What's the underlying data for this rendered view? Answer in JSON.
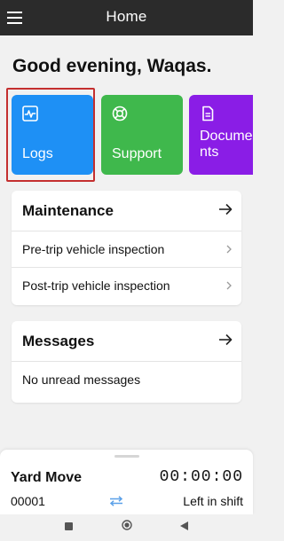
{
  "header": {
    "title": "Home",
    "menu_icon": "hamburger-menu-icon"
  },
  "greeting": "Good evening, Waqas.",
  "tiles": [
    {
      "label": "Logs",
      "icon": "activity-log-icon",
      "color": "#1e90f5"
    },
    {
      "label": "Support",
      "icon": "lifebuoy-icon",
      "color": "#3fb84c"
    },
    {
      "label": "Documents",
      "label_display": "Docume\nnts",
      "icon": "document-icon",
      "color": "#8a1de6"
    }
  ],
  "maintenance": {
    "title": "Maintenance",
    "items": [
      {
        "label": "Pre-trip vehicle inspection"
      },
      {
        "label": "Post-trip vehicle inspection"
      }
    ]
  },
  "messages": {
    "title": "Messages",
    "items": [
      {
        "label": "No unread messages"
      }
    ]
  },
  "status": {
    "title": "Yard Move",
    "timer": "00:00:00",
    "code": "00001",
    "shift_label": "Left in shift"
  },
  "colors": {
    "highlight": "#c42f2f",
    "topbar": "#2b2b2b"
  }
}
